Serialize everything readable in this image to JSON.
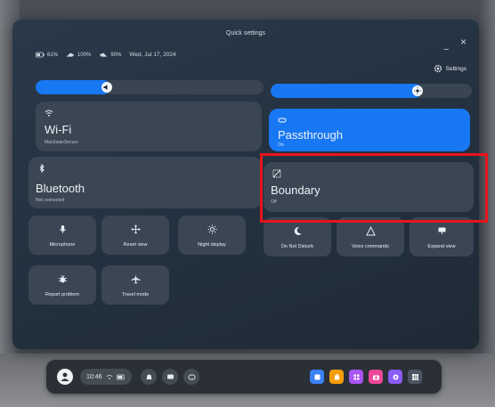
{
  "window": {
    "title": "Quick settings",
    "close_icon": "close-icon",
    "minimize_icon": "minimize-icon"
  },
  "status": {
    "battery_headset": "61%",
    "battery_left": "100%",
    "battery_right": "90%",
    "date": "Wed, Jul 17, 2024"
  },
  "settings": {
    "label": "Settings",
    "icon": "gear-icon"
  },
  "sliders": {
    "volume": {
      "icon": "volume-icon",
      "level": 0.32
    },
    "brightness": {
      "icon": "brightness-icon",
      "level": 0.72
    }
  },
  "tiles": {
    "wifi": {
      "label": "Wi-Fi",
      "sub": "MacEwanSecure",
      "icon": "wifi-icon",
      "on": false
    },
    "passthrough": {
      "label": "Passthrough",
      "sub": "On",
      "icon": "passthrough-icon",
      "on": true
    },
    "bluetooth": {
      "label": "Bluetooth",
      "sub": "Not connected",
      "icon": "bluetooth-icon",
      "on": false
    },
    "boundary": {
      "label": "Boundary",
      "sub": "Off",
      "icon": "boundary-icon",
      "on": false
    }
  },
  "quick_actions": [
    {
      "label": "Microphone",
      "icon": "microphone-icon"
    },
    {
      "label": "Reset view",
      "icon": "reset-view-icon"
    },
    {
      "label": "Night display",
      "icon": "night-display-icon"
    },
    {
      "label": "Do Not Disturb",
      "icon": "moon-icon"
    },
    {
      "label": "Voice commands",
      "icon": "voice-commands-icon"
    },
    {
      "label": "Expand view",
      "icon": "expand-view-icon"
    },
    {
      "label": "Report problem",
      "icon": "bug-icon"
    },
    {
      "label": "Travel mode",
      "icon": "airplane-icon"
    }
  ],
  "taskbar": {
    "time": "10:46",
    "apps": [
      {
        "icon": "app-icon-1",
        "color": "#3b82f6"
      },
      {
        "icon": "app-icon-2",
        "color": "#f59e0b"
      },
      {
        "icon": "app-icon-3",
        "color": "#a855f7"
      },
      {
        "icon": "camera-icon",
        "color": "#ec4899"
      },
      {
        "icon": "app-icon-5",
        "color": "#8b5cf6"
      },
      {
        "icon": "app-grid-icon",
        "color": "#4b5563"
      }
    ]
  },
  "colors": {
    "accent": "#1877f2",
    "highlight": "#e8141c",
    "tile": "#3a4653"
  }
}
